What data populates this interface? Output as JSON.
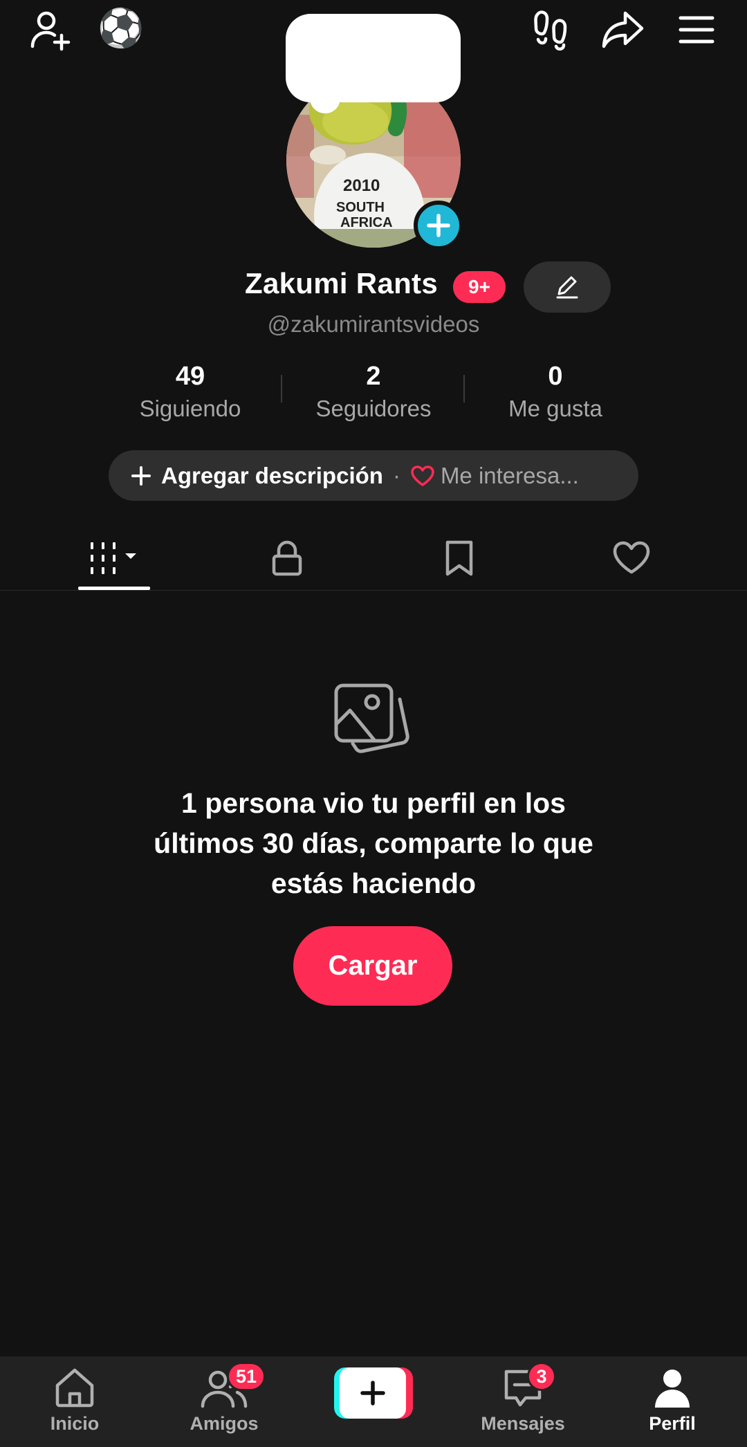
{
  "profile": {
    "display_name": "Zakumi Rants",
    "notification_badge": "9+",
    "username": "@zakumirantsvideos",
    "avatar_shirt_year": "2010",
    "avatar_shirt_text_1": "SOUTH",
    "avatar_shirt_text_2": "AFRICA"
  },
  "stats": [
    {
      "value": "49",
      "label": "Siguiendo"
    },
    {
      "value": "2",
      "label": "Seguidores"
    },
    {
      "value": "0",
      "label": "Me gusta"
    }
  ],
  "description": {
    "add_label": "Agregar descripción",
    "separator": "·",
    "interest_label": "Me interesa..."
  },
  "empty_state": {
    "message": "1 persona vio tu perfil en los últimos 30 días, comparte lo que estás haciendo",
    "button_label": "Cargar"
  },
  "top_bar": {
    "soccer_emoji": "⚽"
  },
  "bottom_nav": {
    "home_label": "Inicio",
    "friends_label": "Amigos",
    "friends_badge": "51",
    "messages_label": "Mensajes",
    "messages_badge": "3",
    "profile_label": "Perfil"
  },
  "colors": {
    "background": "#121212",
    "accent": "#fe2c55",
    "teal": "#20b8d6"
  }
}
